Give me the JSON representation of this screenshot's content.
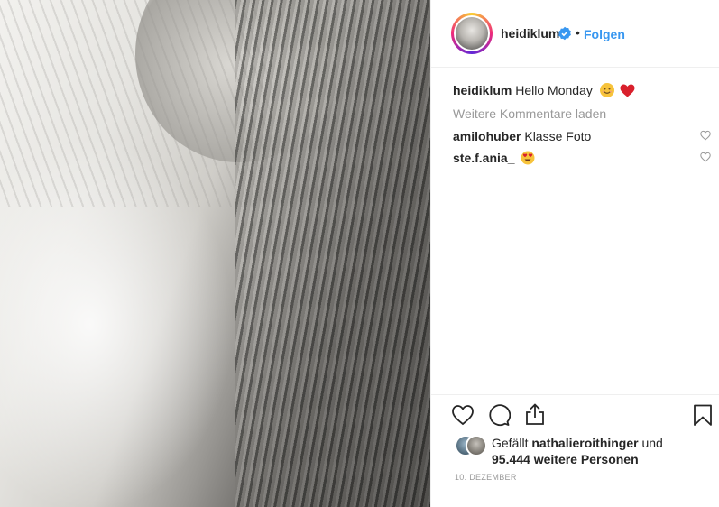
{
  "post": {
    "username": "heidiklum",
    "separator": "•",
    "follow_label": "Folgen"
  },
  "caption": {
    "username": "heidiklum",
    "text": "Hello Monday",
    "emojis": [
      "smiling-face-icon",
      "red-heart-icon"
    ]
  },
  "load_more_label": "Weitere Kommentare laden",
  "comments": [
    {
      "username": "amilohuber",
      "text": "Klasse Foto"
    },
    {
      "username": "ste.f.ania_",
      "text": "",
      "emoji": "heart-eyes-icon"
    }
  ],
  "likes": {
    "prefix": "Gefällt",
    "user": "nathalieroithinger",
    "middle": "und",
    "count": "95.444 weitere Personen"
  },
  "date": "10. DEZEMBER",
  "colors": {
    "accent": "#3897f0",
    "text": "#262626",
    "muted": "#999999",
    "border": "#efefef"
  }
}
